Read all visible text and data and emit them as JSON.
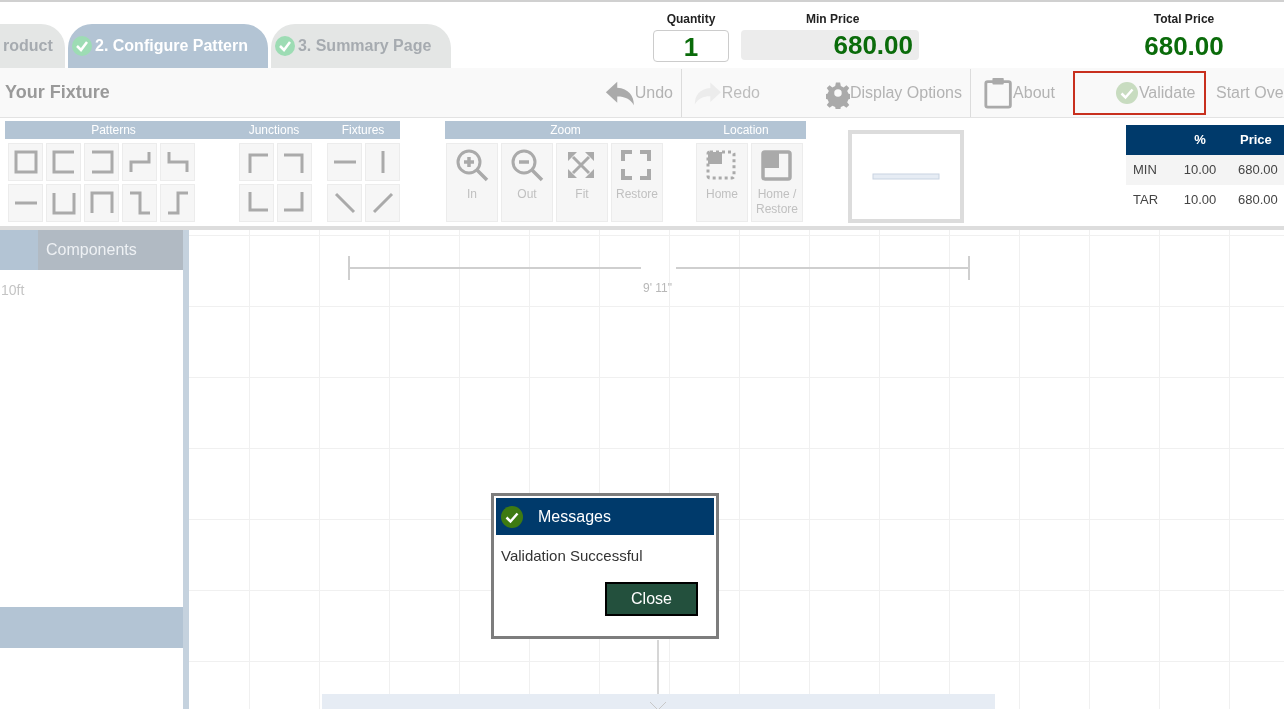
{
  "tabs": [
    {
      "label": "roduct",
      "selected": false,
      "checked": false
    },
    {
      "label": "2. Configure Pattern",
      "selected": true,
      "checked": true
    },
    {
      "label": "3. Summary Page",
      "selected": false,
      "checked": true
    }
  ],
  "pricing": {
    "quantity": {
      "label": "Quantity",
      "value": "1"
    },
    "min_price": {
      "label": "Min Price",
      "value": "680.00"
    },
    "total_price": {
      "label": "Total Price",
      "value": "680.00"
    }
  },
  "toolbar": {
    "title": "Your Fixture",
    "buttons": [
      {
        "kind": "undo",
        "label": "Undo",
        "highlighted": false
      },
      {
        "kind": "separator"
      },
      {
        "kind": "redo",
        "label": "Redo",
        "highlighted": false
      },
      {
        "kind": "options",
        "label": "Display Options",
        "highlighted": false
      },
      {
        "kind": "separator"
      },
      {
        "kind": "about",
        "label": "About",
        "highlighted": false
      },
      {
        "kind": "validate",
        "label": "Validate",
        "highlighted": true
      },
      {
        "kind": "start_over",
        "label": "Start Ove",
        "highlighted": false
      }
    ]
  },
  "palette": {
    "groups": [
      {
        "title": "Patterns",
        "tiles": [
          {
            "kind": "square"
          },
          {
            "kind": "bracket_left"
          },
          {
            "kind": "bracket_right"
          },
          {
            "kind": "step_a"
          },
          {
            "kind": "step_b"
          },
          {
            "kind": "line_h"
          },
          {
            "kind": "cup"
          },
          {
            "kind": "cap"
          },
          {
            "kind": "z_step"
          },
          {
            "kind": "s_step"
          }
        ]
      },
      {
        "title": "Junctions",
        "tiles": [
          {
            "kind": "corner_tl"
          },
          {
            "kind": "corner_tr"
          },
          {
            "kind": "corner_bl"
          },
          {
            "kind": "corner_br"
          }
        ]
      },
      {
        "title": "Fixtures",
        "tiles": [
          {
            "kind": "line_h"
          },
          {
            "kind": "line_v"
          },
          {
            "kind": "diag_down"
          },
          {
            "kind": "diag_up"
          }
        ]
      }
    ],
    "view_groups": [
      {
        "title": "Zoom",
        "tools": [
          {
            "kind": "zoom_in",
            "label": "In"
          },
          {
            "kind": "zoom_out",
            "label": "Out"
          },
          {
            "kind": "fit",
            "label": "Fit"
          },
          {
            "kind": "restore",
            "label": "Restore"
          }
        ]
      },
      {
        "title": "Location",
        "tools": [
          {
            "kind": "home",
            "label": "Home"
          },
          {
            "kind": "home_restore",
            "label": "Home / Restore"
          }
        ]
      }
    ]
  },
  "price_table": {
    "columns": [
      "%",
      "Price"
    ],
    "rows": [
      {
        "label": "MIN",
        "percent": "10.00",
        "price": "680.00"
      },
      {
        "label": "TAR",
        "percent": "10.00",
        "price": "680.00"
      }
    ]
  },
  "components_panel": {
    "tab": "Components",
    "items": [
      "10ft"
    ]
  },
  "canvas": {
    "dimension": "9' 11\""
  },
  "dialog": {
    "title": "Messages",
    "message": "Validation Successful",
    "button": "Close"
  }
}
